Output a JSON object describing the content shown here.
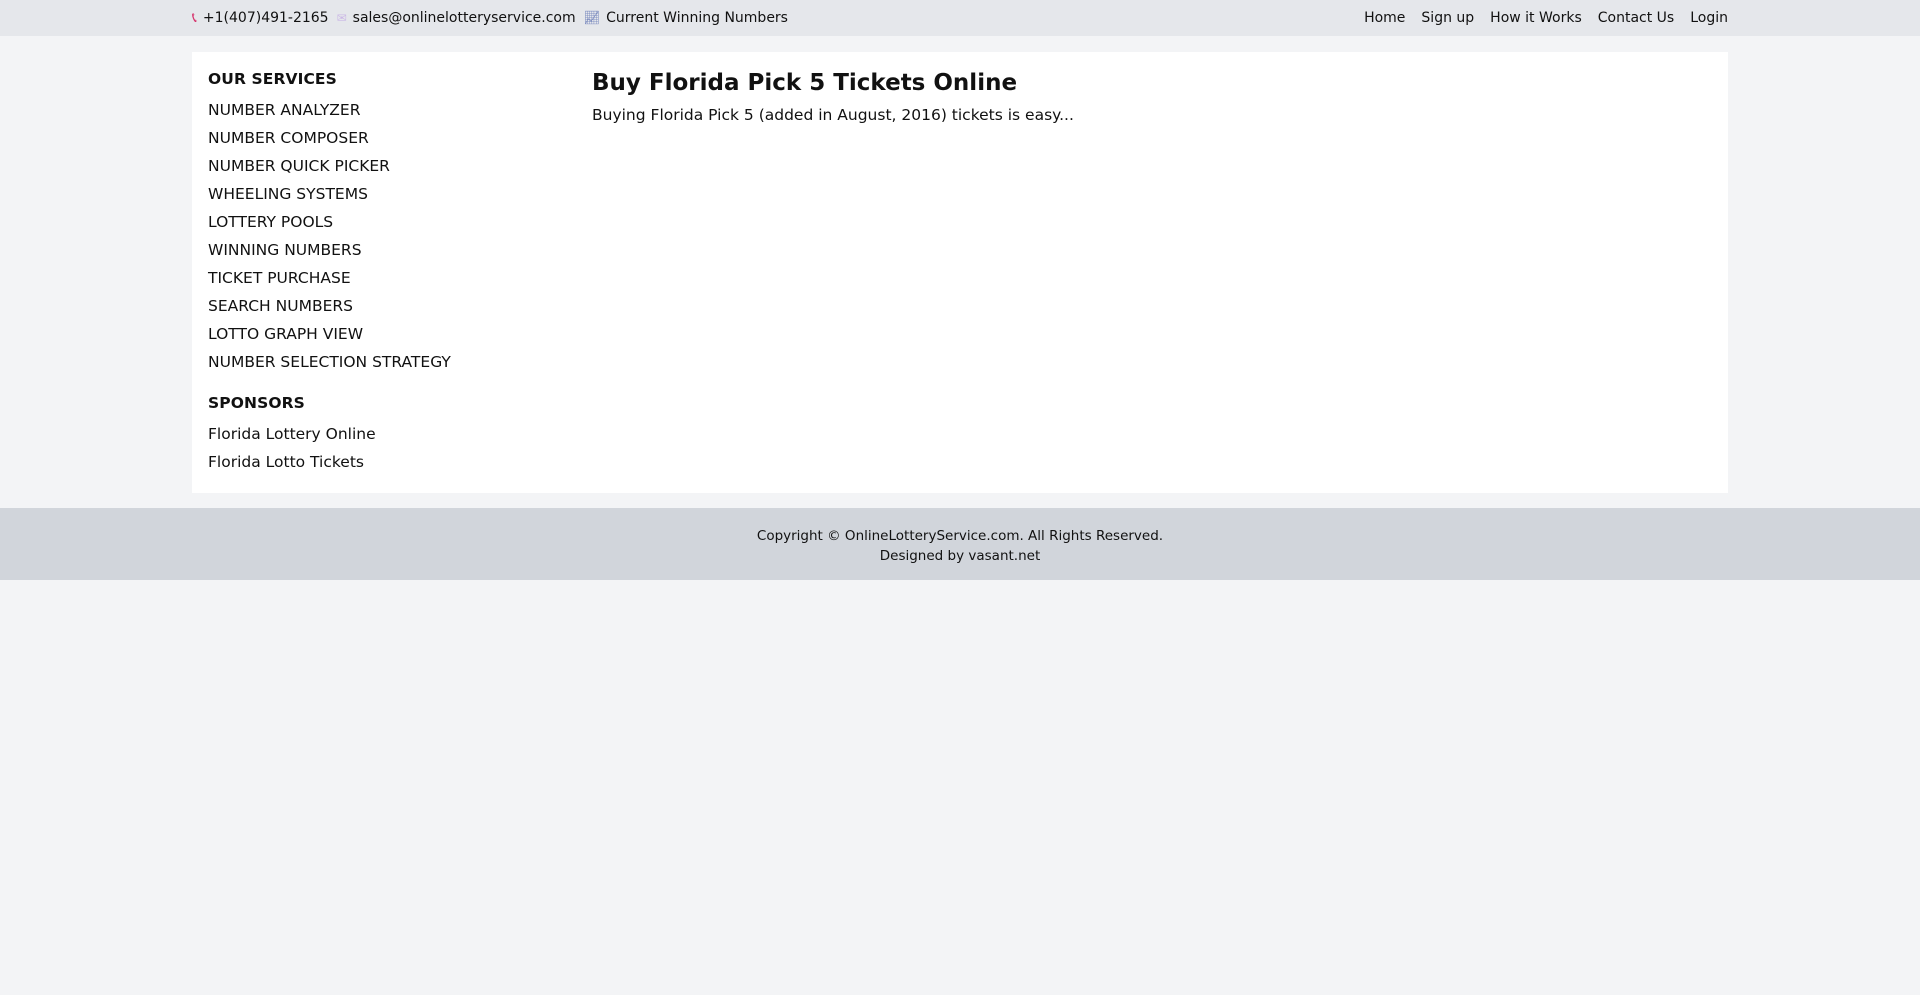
{
  "topbar": {
    "phone_icon": "phone-icon",
    "phone": "+1(407)491-2165",
    "email_icon": "email-icon",
    "email": "sales@onlinelotteryservice.com",
    "chart_icon": "chart-icon",
    "winning_numbers": "Current Winning Numbers",
    "nav": [
      {
        "label": "Home"
      },
      {
        "label": "Sign up"
      },
      {
        "label": "How it Works"
      },
      {
        "label": "Contact Us"
      },
      {
        "label": "Login"
      }
    ]
  },
  "sidebar": {
    "services_heading": "OUR SERVICES",
    "services": [
      {
        "label": "NUMBER ANALYZER"
      },
      {
        "label": "NUMBER COMPOSER"
      },
      {
        "label": "NUMBER QUICK PICKER"
      },
      {
        "label": "WHEELING SYSTEMS"
      },
      {
        "label": "LOTTERY POOLS"
      },
      {
        "label": "WINNING NUMBERS"
      },
      {
        "label": "TICKET PURCHASE"
      },
      {
        "label": "SEARCH NUMBERS"
      },
      {
        "label": "LOTTO GRAPH VIEW"
      },
      {
        "label": "NUMBER SELECTION STRATEGY"
      }
    ],
    "sponsors_heading": "SPONSORS",
    "sponsors": [
      {
        "label": "Florida Lottery Online"
      },
      {
        "label": "Florida Lotto Tickets"
      }
    ]
  },
  "main": {
    "title": "Buy Florida Pick 5 Tickets Online",
    "intro": "Buying Florida Pick 5 (added in August, 2016) tickets is easy..."
  },
  "footer": {
    "copyright": "Copyright © OnlineLotteryService.com. All Rights Reserved.",
    "designed_by": "Designed by vasant.net"
  },
  "colors": {
    "page_bg": "#f3f4f6",
    "topbar_bg": "#e5e7eb",
    "footer_bg": "#d1d5db",
    "phone_icon": "#d6336c"
  }
}
